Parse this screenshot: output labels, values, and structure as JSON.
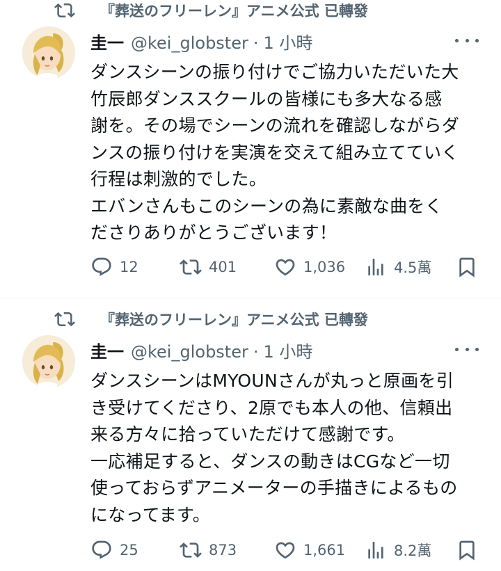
{
  "tweets": [
    {
      "retweet_label": "『葬送のフリーレン』アニメ公式 已轉發",
      "author_name": "圭一",
      "handle": "@kei_globster",
      "separator": "·",
      "time": "1 小時",
      "text": "ダンスシーンの振り付けでご協力いただいた大\n竹辰郎ダンススクールの皆様にも多大なる感\n謝を。その場でシーンの流れを確認しながらダ\nンスの振り付けを実演を交えて組み立てていく\n行程は刺激的でした。\nエバンさんもこのシーンの為に素敵な曲をく\nださりありがとうございます！",
      "replies": "12",
      "retweets": "401",
      "likes": "1,036",
      "views": "4.5萬"
    },
    {
      "retweet_label": "『葬送のフリーレン』アニメ公式 已轉發",
      "author_name": "圭一",
      "handle": "@kei_globster",
      "separator": "·",
      "time": "1 小時",
      "text": "ダンスシーンはMYOUNさんが丸っと原画を引\nき受けてくださり、2原でも本人の他、信頼出\n来る方々に拾っていただけて感謝です。\n一応補足すると、ダンスの動きはCGなど一切\n使っておらずアニメーターの手描きによるもの\nになってます。",
      "replies": "25",
      "retweets": "873",
      "likes": "1,661",
      "views": "8.2萬"
    }
  ],
  "colors": {
    "text": "#0f1419",
    "secondary": "#536471",
    "divider": "#eff3f4"
  },
  "icons": [
    "retweet-icon",
    "more-icon",
    "reply-icon",
    "like-icon",
    "views-icon",
    "bookmark-icon"
  ]
}
